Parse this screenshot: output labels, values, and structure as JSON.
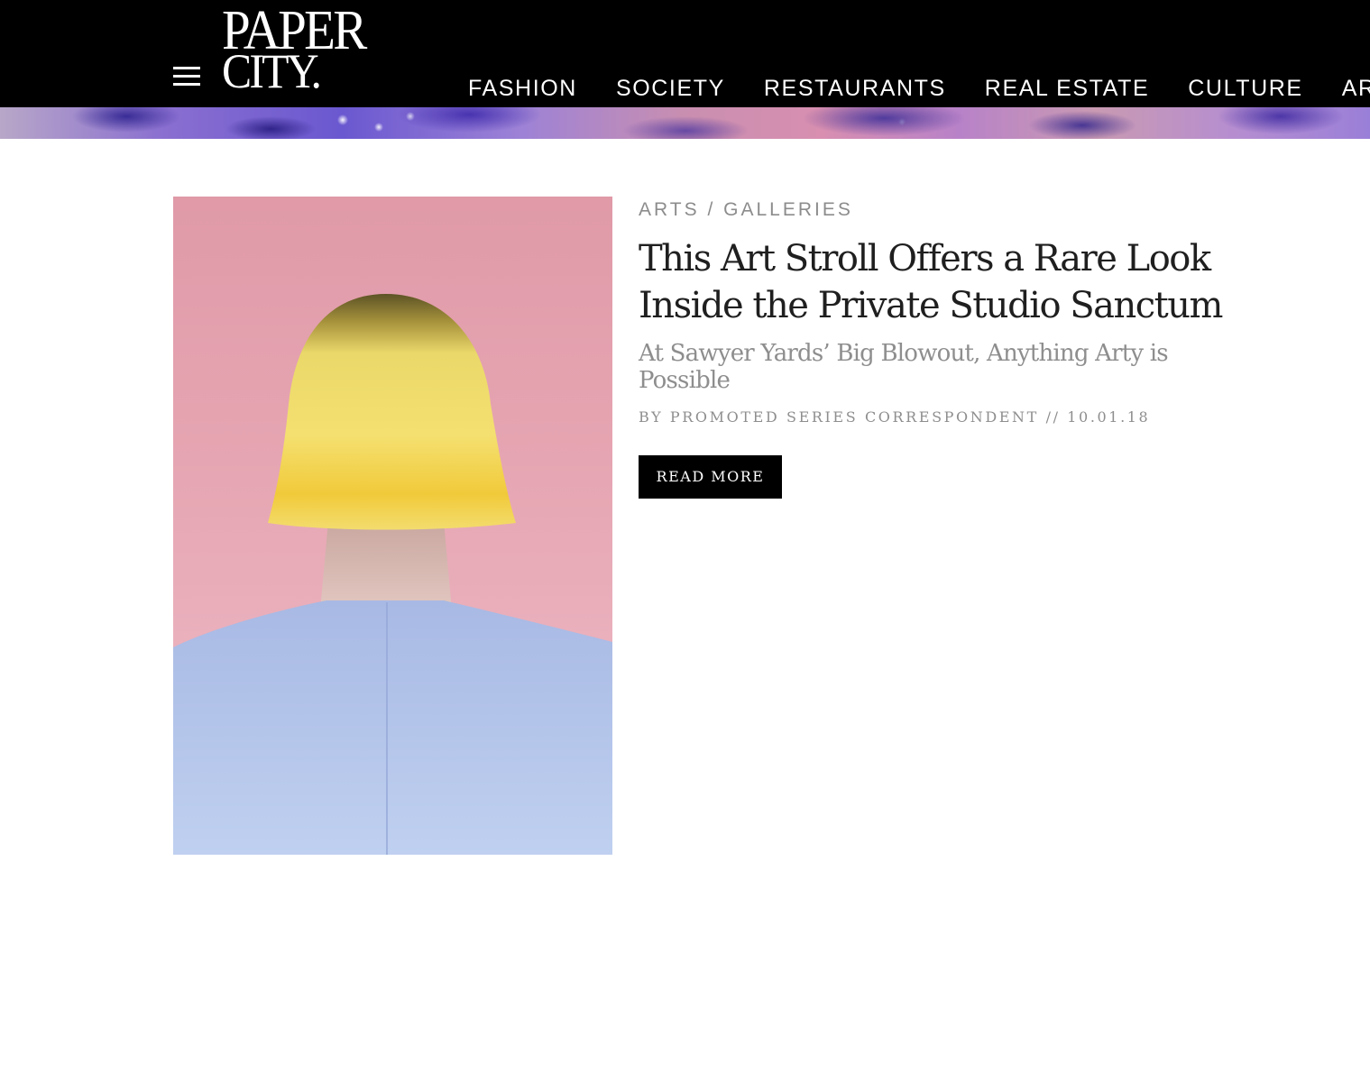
{
  "header": {
    "logo_line1": "PAPER",
    "logo_line2": "CITY.",
    "nav": [
      {
        "label": "FASHION"
      },
      {
        "label": "SOCIETY"
      },
      {
        "label": "RESTAURANTS"
      },
      {
        "label": "REAL ESTATE"
      },
      {
        "label": "CULTURE"
      },
      {
        "label": "ARTS"
      }
    ]
  },
  "article": {
    "category": "ARTS / GALLERIES",
    "title": "This Art Stroll Offers a Rare Look Inside the Private Studio Sanctum",
    "subtitle": "At Sawyer Yards’ Big Blowout, Anything Arty is Possible",
    "byline": "BY PROMOTED SERIES CORRESPONDENT // 10.01.18",
    "read_more_label": "READ MORE"
  },
  "colors": {
    "header_bg": "#000000",
    "header_text": "#ffffff",
    "meta_gray": "#8c8c8c",
    "title_text": "#1f1f1f",
    "button_bg": "#000000",
    "image_bg_pink": "#e6a5b2",
    "hair_yellow": "#f4df5e",
    "shirt_blue": "#b4c6ec"
  },
  "icons": {
    "menu": "hamburger-menu-icon"
  }
}
